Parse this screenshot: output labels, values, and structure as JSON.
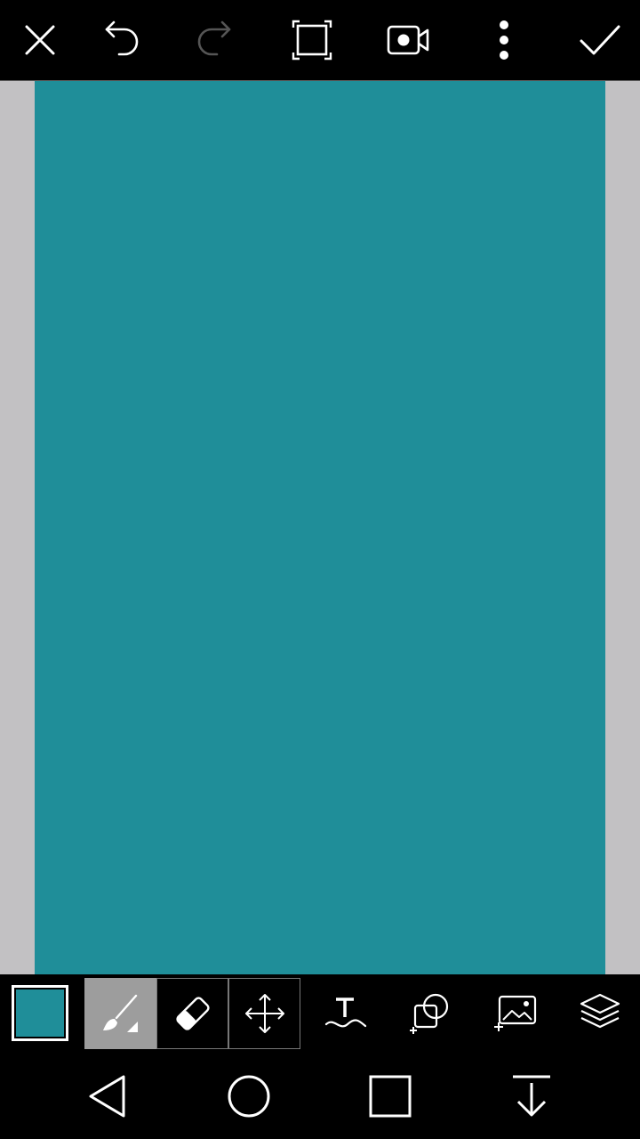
{
  "colors": {
    "canvas": "#1f8e99",
    "workspace": "#c2c1c3",
    "bar": "#000000",
    "active_tool": "#9d9d9d",
    "icon": "#ffffff",
    "icon_disabled": "#555555"
  },
  "top_toolbar": {
    "icons": [
      "close-icon",
      "undo-icon",
      "redo-icon",
      "fullscreen-icon",
      "record-video-icon",
      "more-options-icon",
      "confirm-icon"
    ],
    "redo_enabled": false
  },
  "bottom_toolbar": {
    "current_color": "#1f8e99",
    "tools": [
      "brush-icon",
      "eraser-icon",
      "move-icon",
      "text-icon",
      "shape-icon",
      "add-image-icon",
      "layers-icon"
    ],
    "active_tool": "brush-icon"
  },
  "nav_bar": {
    "icons": [
      "back-icon",
      "home-icon",
      "recents-icon",
      "hide-nav-icon"
    ]
  }
}
